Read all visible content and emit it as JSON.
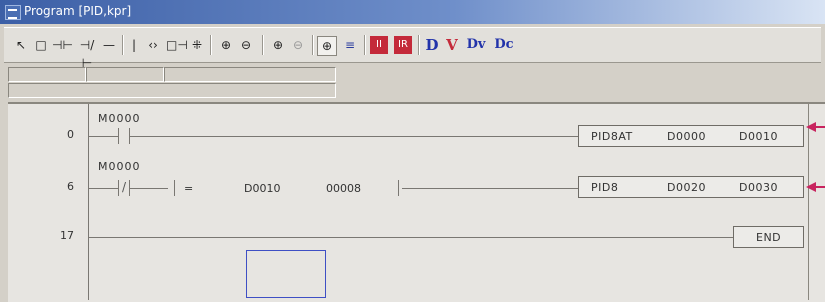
{
  "window": {
    "title": "Program [PID,kpr]"
  },
  "toolbar": {
    "tools": [
      "↖",
      "□",
      "⊣⊢",
      "⊣/⊢",
      "—",
      "|",
      "‹›",
      "□⊣",
      "⁜",
      "⊕",
      "⊖",
      "⊕",
      "⊖",
      "⊕",
      "≡",
      "II",
      "IR",
      "D",
      "V",
      "Dv",
      "Dc"
    ]
  },
  "ladder": {
    "rungs": [
      {
        "step": "0",
        "contact": "M0000",
        "instruction": {
          "op": "PID8AT",
          "arg1": "D0000",
          "arg2": "D0010"
        }
      },
      {
        "step": "6",
        "contact": "M0000",
        "compare": {
          "op": "=",
          "arg1": "D0010",
          "arg2": "00008"
        },
        "instruction": {
          "op": "PID8",
          "arg1": "D0020",
          "arg2": "D0030"
        }
      },
      {
        "step": "17",
        "instruction": {
          "op": "END"
        }
      }
    ]
  },
  "colors": {
    "arrow": "#c8245f",
    "cursor": "#3f4fc4"
  }
}
